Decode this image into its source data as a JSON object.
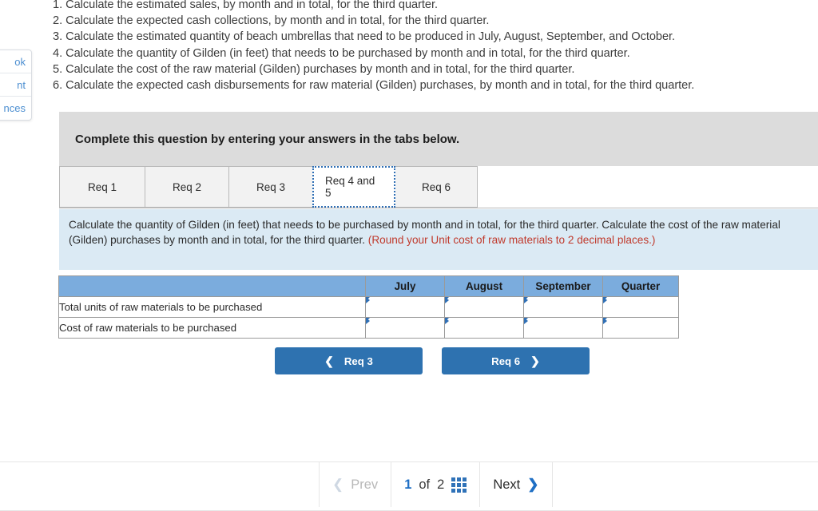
{
  "sidebar": {
    "items": [
      {
        "label": "ok"
      },
      {
        "label": "nt"
      },
      {
        "label": "nces"
      }
    ]
  },
  "requirements": {
    "lines": [
      "1. Calculate the estimated sales, by month and in total, for the third quarter.",
      "2. Calculate the expected cash collections, by month and in total, for the third quarter.",
      "3. Calculate the estimated quantity of beach umbrellas that need to be produced in July, August, September, and October.",
      "4. Calculate the quantity of Gilden (in feet) that needs to be purchased by month and in total, for the third quarter.",
      "5. Calculate the cost of the raw material (Gilden) purchases by month and in total, for the third quarter.",
      "6. Calculate the expected cash disbursements for raw material (Gilden) purchases, by month and in total, for the third quarter."
    ]
  },
  "banner": {
    "text": "Complete this question by entering your answers in the tabs below."
  },
  "tabs": {
    "items": [
      {
        "label": "Req 1",
        "active": false
      },
      {
        "label": "Req 2",
        "active": false
      },
      {
        "label": "Req 3",
        "active": false
      },
      {
        "label": "Req 4 and 5",
        "active": true
      },
      {
        "label": "Req 6",
        "active": false
      }
    ]
  },
  "instruction": {
    "part1": "Calculate the quantity of Gilden (in feet) that needs to be purchased by month and in total, for the third quarter. Calculate the cost of the raw material (Gilden) purchases by month and in total, for the third quarter. ",
    "part2_red": "(Round your Unit cost of raw materials to 2 decimal places.)"
  },
  "answer_table": {
    "headers": [
      "",
      "July",
      "August",
      "September",
      "Quarter"
    ],
    "rows": [
      {
        "label": "Total units of raw materials to be purchased",
        "values": [
          "",
          "",
          "",
          ""
        ]
      },
      {
        "label": "Cost of raw materials to be purchased",
        "values": [
          "",
          "",
          "",
          ""
        ]
      }
    ]
  },
  "req_nav": {
    "prev_label": "Req 3",
    "prev_icon": "chevron-left-icon",
    "next_label": "Req 6",
    "next_icon": "chevron-right-icon"
  },
  "pagination": {
    "prev_label": "Prev",
    "current_page": "1",
    "of_label": "of",
    "total_pages": "2",
    "grid_icon": "grid-view-icon",
    "next_label": "Next"
  },
  "colors": {
    "accent_blue": "#2e72b0",
    "table_header_blue": "#7bacdd",
    "panel_blue": "#dbeaf4",
    "banner_gray": "#dcdcdc",
    "warning_red": "#c0392b",
    "link_blue": "#1f6fc4"
  }
}
